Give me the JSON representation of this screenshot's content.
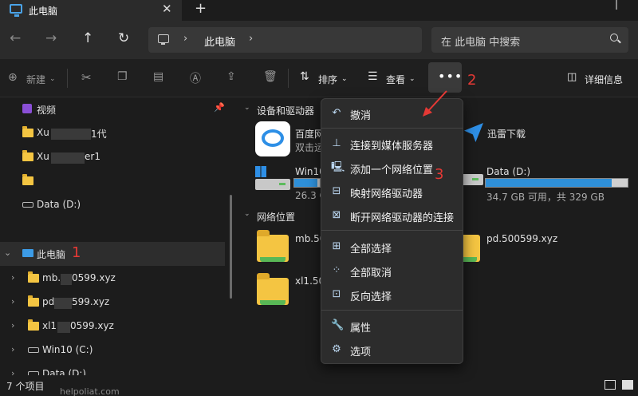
{
  "titlebar": {
    "tab_title": "此电脑",
    "new_tab": "+",
    "close_tab": "✕"
  },
  "nav": {
    "back": "←",
    "forward": "→",
    "up": "↑",
    "refresh": "↻",
    "address_text": "此电脑",
    "search_placeholder": "在 此电脑 中搜索"
  },
  "toolbar": {
    "new_label": "新建",
    "sort_label": "排序",
    "view_label": "查看",
    "more_label": "•••",
    "details_label": "详细信息"
  },
  "sidebar": {
    "items": [
      {
        "label": "视频",
        "type": "video"
      },
      {
        "label": "Xu",
        "suffix": "1代",
        "type": "folder"
      },
      {
        "label": "Xu",
        "suffix": "er1",
        "type": "folder"
      },
      {
        "label": "",
        "type": "folder"
      },
      {
        "label": "Data (D:)",
        "type": "drive"
      },
      {
        "label": "此电脑",
        "type": "pc",
        "selected": true
      },
      {
        "label": "mb.",
        "suffix": "0599.xyz",
        "type": "folder"
      },
      {
        "label": "pd",
        "suffix": "599.xyz",
        "type": "folder"
      },
      {
        "label": "xl1",
        "suffix": "0599.xyz",
        "type": "folder"
      },
      {
        "label": "Win10 (C:)",
        "type": "drive"
      },
      {
        "label": "Data (D:)",
        "type": "drive"
      }
    ]
  },
  "main": {
    "section_devices": "设备和驱动器",
    "section_network": "网络位置",
    "baidu_name": "百度网",
    "baidu_sub": "双击运",
    "xunlei_name": "迅雷下载",
    "c_drive_name": "Win10",
    "c_drive_info": "26.3 C",
    "c_drive_used": 0.9,
    "d_drive_name": "Data (D:)",
    "d_drive_info": "34.7 GB 可用，共 329 GB",
    "d_drive_used": 0.89,
    "net_items": [
      "mb.500",
      "pd.500599.xyz",
      "xl1.50"
    ]
  },
  "status": {
    "count": "7 个项目"
  },
  "menu": {
    "items": [
      {
        "label": "撤消",
        "icon": "undo-icon"
      },
      {
        "label": "连接到媒体服务器",
        "icon": "media-server-icon"
      },
      {
        "label": "添加一个网络位置",
        "icon": "network-location-icon"
      },
      {
        "label": "映射网络驱动器",
        "icon": "map-drive-icon"
      },
      {
        "label": "断开网络驱动器的连接",
        "icon": "disconnect-drive-icon"
      },
      {
        "label": "全部选择",
        "icon": "select-all-icon"
      },
      {
        "label": "全部取消",
        "icon": "select-none-icon"
      },
      {
        "label": "反向选择",
        "icon": "invert-selection-icon"
      },
      {
        "label": "属性",
        "icon": "properties-icon"
      },
      {
        "label": "选项",
        "icon": "options-icon"
      }
    ]
  },
  "annotations": {
    "one": "1",
    "two": "2",
    "three": "3"
  },
  "watermark": "helpoliat.com"
}
